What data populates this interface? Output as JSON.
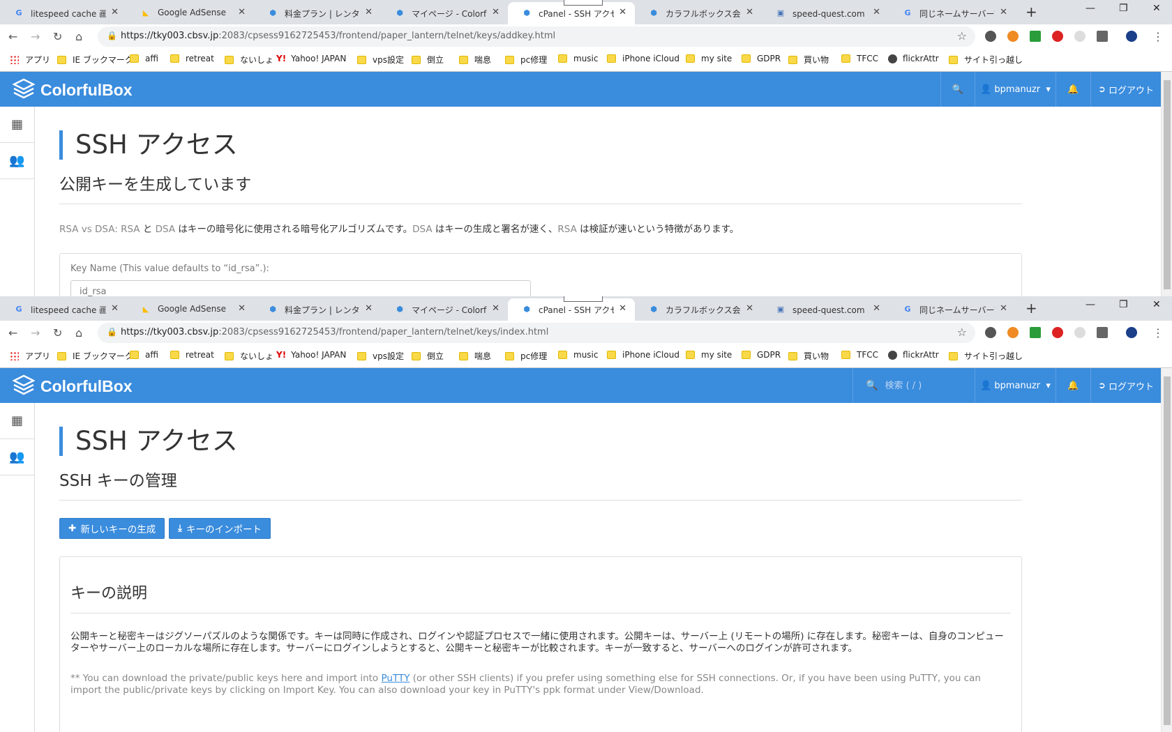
{
  "tabs": [
    {
      "label": "litespeed cache 画像最",
      "favicon": "google-icon"
    },
    {
      "label": "Google AdSense",
      "favicon": "adsense-icon"
    },
    {
      "label": "料金プラン | レンタルサー",
      "favicon": "colorfulbox-icon"
    },
    {
      "label": "マイページ - ColorfulBox",
      "favicon": "colorfulbox-icon"
    },
    {
      "label": "cPanel - SSH アクセス",
      "favicon": "colorfulbox-icon"
    },
    {
      "label": "カラフルボックス会員規約",
      "favicon": "colorfulbox-icon"
    },
    {
      "label": "speed-quest.com のデ",
      "favicon": "site-icon"
    },
    {
      "label": "同じネームサーバーで同じ",
      "favicon": "google-icon"
    }
  ],
  "active_tab_index": 4,
  "bookmarks": [
    {
      "label": "アプリ",
      "icon": "apps-icon"
    },
    {
      "label": "IE ブックマーク",
      "icon": "folder-icon"
    },
    {
      "label": "affi",
      "icon": "folder-icon"
    },
    {
      "label": "retreat",
      "icon": "folder-icon"
    },
    {
      "label": "ないしょ",
      "icon": "folder-icon"
    },
    {
      "label": "Yahoo! JAPAN",
      "icon": "yahoo-icon"
    },
    {
      "label": "vps設定",
      "icon": "folder-icon"
    },
    {
      "label": "倒立",
      "icon": "folder-icon"
    },
    {
      "label": "喘息",
      "icon": "folder-icon"
    },
    {
      "label": "pc修理",
      "icon": "folder-icon"
    },
    {
      "label": "music",
      "icon": "folder-icon"
    },
    {
      "label": "iPhone iCloud",
      "icon": "folder-icon"
    },
    {
      "label": "my site",
      "icon": "folder-icon"
    },
    {
      "label": "GDPR",
      "icon": "folder-icon"
    },
    {
      "label": "買い物",
      "icon": "folder-icon"
    },
    {
      "label": "TFCC",
      "icon": "folder-icon"
    },
    {
      "label": "flickrAttr",
      "icon": "globe-icon"
    },
    {
      "label": "サイト引っ越し",
      "icon": "folder-icon"
    }
  ],
  "brand": {
    "name": "ColorfulBox",
    "header_color": "#3a8cdd"
  },
  "header": {
    "user": "bpmanuzr",
    "logout": "ログアウト",
    "search_placeholder": "検索 ( / )"
  },
  "top_window": {
    "url_host": "https://tky003.cbsv.jp",
    "url_path": ":2083/cpsess9162725453/frontend/paper_lantern/telnet/keys/addkey.html",
    "page_title": "SSH アクセス",
    "subtitle": "公開キーを生成しています",
    "desc": {
      "p1": "RSA vs DSA:",
      "p2": "RSA",
      "p3": "と",
      "p4": "DSA",
      "p5": "はキーの暗号化に使用される暗号化アルゴリズムです。",
      "p6": "DSA",
      "p7": "はキーの生成と署名が速く、",
      "p8": "RSA",
      "p9": "は検証が速いという特徴があります。"
    },
    "key_name_label": "Key Name (This value defaults to “id_rsa”.):",
    "key_name_value": "id_rsa"
  },
  "bottom_window": {
    "url_host": "https://tky003.cbsv.jp",
    "url_path": ":2083/cpsess9162725453/frontend/paper_lantern/telnet/keys/index.html",
    "page_title": "SSH アクセス",
    "subtitle": "SSH キーの管理",
    "btn_generate": "新しいキーの生成",
    "btn_import": "キーのインポート",
    "panel_title": "キーの説明",
    "panel_text": "公開キーと秘密キーはジグソーパズルのような関係です。キーは同時に作成され、ログインや認証プロセスで一緒に使用されます。公開キーは、サーバー上 (リモートの場所) に存在します。秘密キーは、自身のコンピューターやサーバー上のローカルな場所に存在します。サーバーにログインしようとすると、公開キーと秘密キーが比較されます。キーが一致すると、サーバーへのログインが許可されます。",
    "note_pre": "** You can download the private/public keys here and import into ",
    "note_link": "PuTTY",
    "note_post": " (or other SSH clients) if you prefer using something else for SSH connections. Or, if you have been using PuTTY, you can import the public/private keys by clicking on Import Key. You can also download your key in PuTTY's ppk format under View/Download."
  }
}
